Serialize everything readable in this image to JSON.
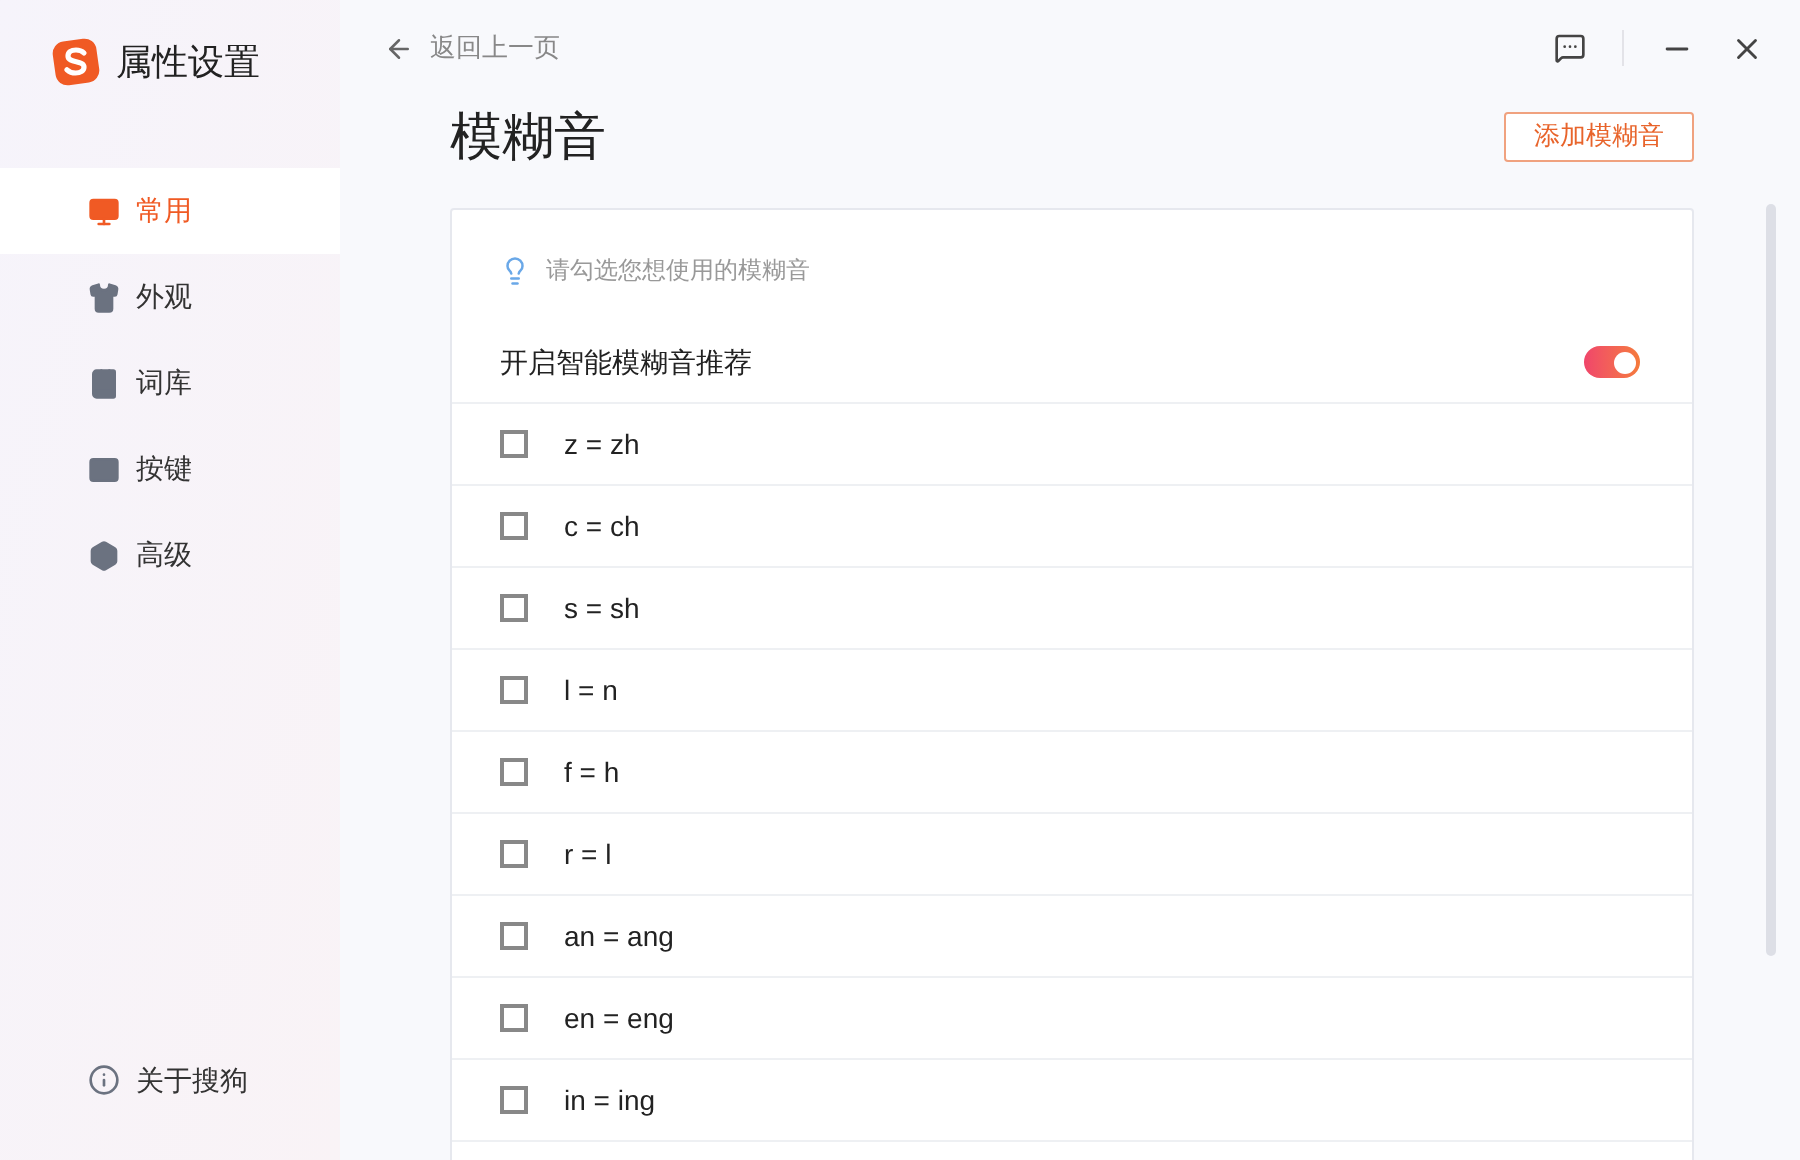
{
  "app": {
    "title": "属性设置"
  },
  "sidebar": {
    "items": [
      {
        "label": "常用",
        "selected": true
      },
      {
        "label": "外观",
        "selected": false
      },
      {
        "label": "词库",
        "selected": false
      },
      {
        "label": "按键",
        "selected": false
      },
      {
        "label": "高级",
        "selected": false
      }
    ],
    "footer": {
      "label": "关于搜狗"
    }
  },
  "back_link": "返回上一页",
  "page": {
    "title": "模糊音",
    "add_button": "添加模糊音"
  },
  "hint": "请勾选您想使用的模糊音",
  "smart_toggle": {
    "label": "开启智能模糊音推荐",
    "on": true
  },
  "options": [
    {
      "label": "z = zh",
      "checked": false
    },
    {
      "label": "c = ch",
      "checked": false
    },
    {
      "label": "s = sh",
      "checked": false
    },
    {
      "label": "l = n",
      "checked": false
    },
    {
      "label": "f = h",
      "checked": false
    },
    {
      "label": "r = l",
      "checked": false
    },
    {
      "label": "an = ang",
      "checked": false
    },
    {
      "label": "en = eng",
      "checked": false
    },
    {
      "label": "in = ing",
      "checked": false
    }
  ]
}
